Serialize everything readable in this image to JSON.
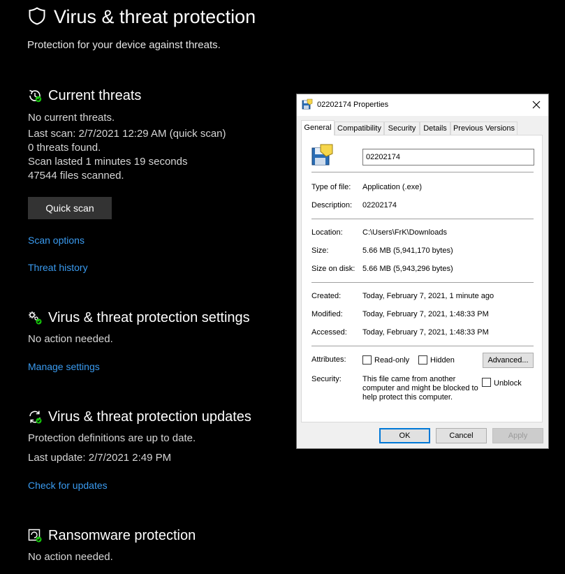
{
  "security": {
    "title": "Virus & threat protection",
    "subtitle": "Protection for your device against threats.",
    "current_threats": {
      "title": "Current threats",
      "lines": [
        "No current threats.",
        "Last scan: 2/7/2021 12:29 AM (quick scan)",
        "0 threats found.",
        "Scan lasted 1 minutes 19 seconds",
        "47544 files scanned."
      ],
      "quick_scan_label": "Quick scan",
      "scan_options_label": "Scan options",
      "threat_history_label": "Threat history"
    },
    "settings": {
      "title": "Virus & threat protection settings",
      "status": "No action needed.",
      "manage_label": "Manage settings"
    },
    "updates": {
      "title": "Virus & threat protection updates",
      "status": "Protection definitions are up to date.",
      "last_update": "Last update: 2/7/2021 2:49 PM",
      "check_label": "Check for updates"
    },
    "ransomware": {
      "title": "Ransomware protection",
      "status": "No action needed."
    },
    "colors": {
      "link": "#3a9bf0",
      "accent_check": "#16c60c"
    }
  },
  "dialog": {
    "title": "02202174 Properties",
    "tabs": [
      "General",
      "Compatibility",
      "Security",
      "Details",
      "Previous Versions"
    ],
    "active_tab": "General",
    "file_name": "02202174",
    "type_label": "Type of file:",
    "type_value": "Application (.exe)",
    "description_label": "Description:",
    "description_value": "02202174",
    "location_label": "Location:",
    "location_value": "C:\\Users\\FrK\\Downloads",
    "size_label": "Size:",
    "size_value": "5.66 MB (5,941,170 bytes)",
    "size_on_disk_label": "Size on disk:",
    "size_on_disk_value": "5.66 MB (5,943,296 bytes)",
    "created_label": "Created:",
    "created_value": "Today, February 7, 2021, 1 minute ago",
    "modified_label": "Modified:",
    "modified_value": "Today, February 7, 2021, 1:48:33 PM",
    "accessed_label": "Accessed:",
    "accessed_value": "Today, February 7, 2021, 1:48:33 PM",
    "attributes_label": "Attributes:",
    "readonly_label": "Read-only",
    "hidden_label": "Hidden",
    "advanced_label": "Advanced...",
    "security_label": "Security:",
    "security_text_1": "This file came from another",
    "security_text_2": "computer and might be blocked to",
    "security_text_3": "help protect this computer.",
    "unblock_label": "Unblock",
    "ok_label": "OK",
    "cancel_label": "Cancel",
    "apply_label": "Apply"
  }
}
